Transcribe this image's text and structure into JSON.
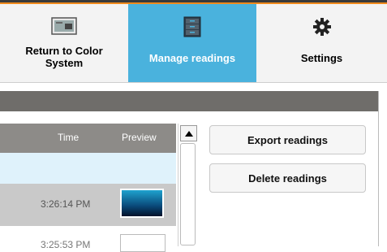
{
  "toolbar": {
    "return_label": "Return to Color System",
    "manage_label": "Manage readings",
    "settings_label": "Settings",
    "active_color": "#4ab2dd",
    "accent_color": "#f08a1c"
  },
  "table": {
    "headers": [
      "Time",
      "Preview"
    ],
    "rows": [
      {
        "time": "3:26:14 PM",
        "preview": "dark-blue-gradient"
      },
      {
        "time": "3:25:53 PM",
        "preview": "white"
      }
    ]
  },
  "actions": {
    "export_label": "Export readings",
    "delete_label": "Delete readings"
  },
  "icons": {
    "return": "monitor-icon",
    "manage": "cabinet-icon",
    "settings": "gear-icon",
    "scroll_up": "triangle-up-icon"
  }
}
